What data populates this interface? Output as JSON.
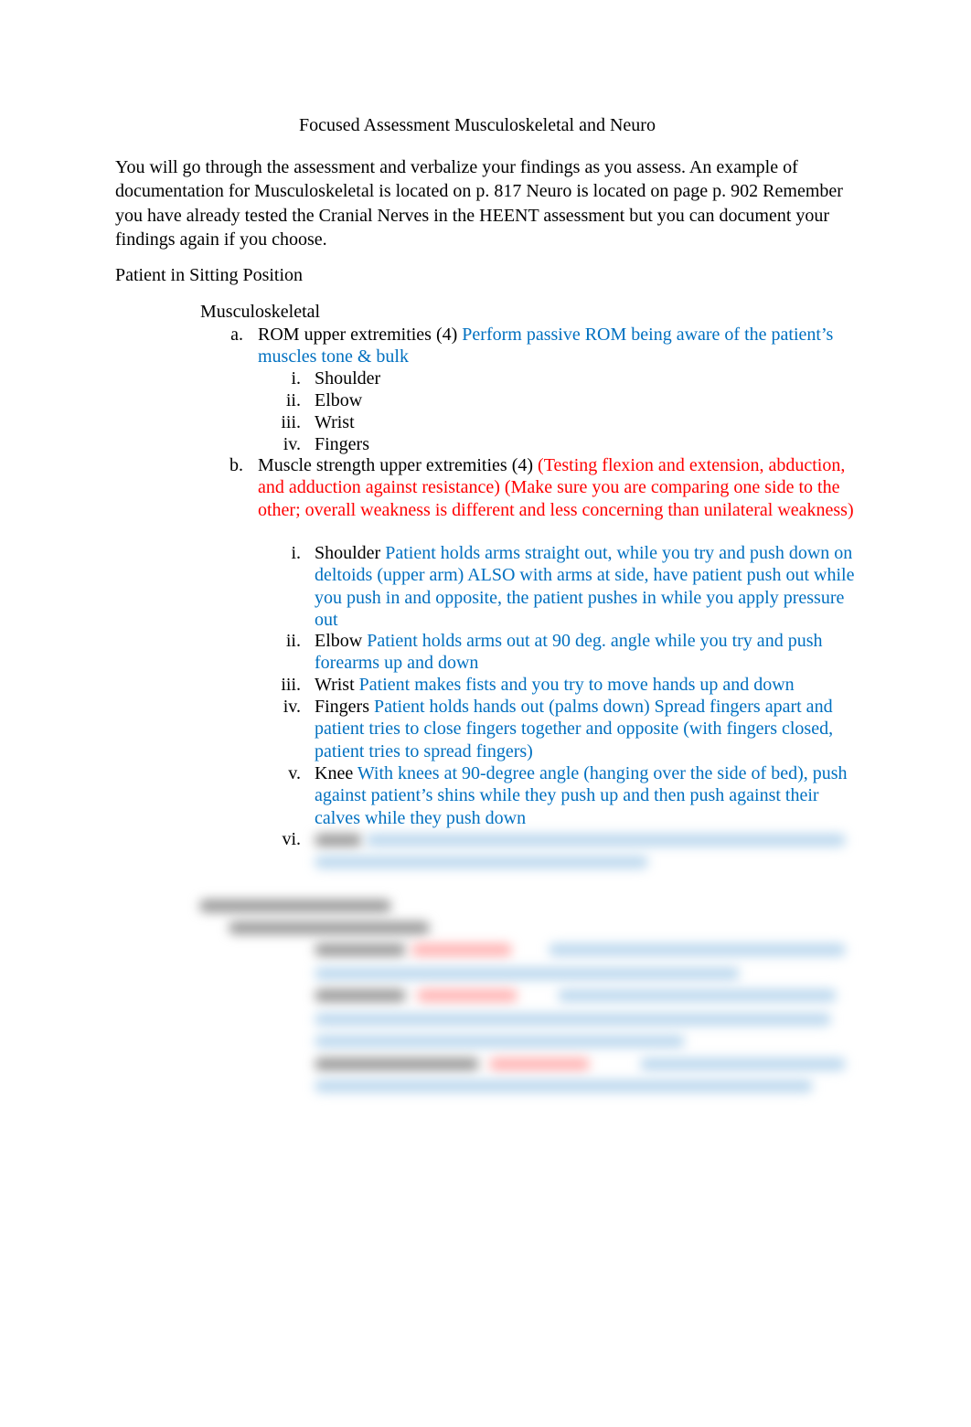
{
  "document": {
    "title": "Focused Assessment Musculoskeletal and Neuro",
    "intro": "You will go through the assessment and verbalize your findings as you assess. An example of documentation for Musculoskeletal is located on p. 817 Neuro is located on page p. 902 Remember you have already tested the Cranial Nerves in the HEENT assessment but you can document your findings again if you choose.",
    "section_heading": "Patient in Sitting Position",
    "subsection_heading": "Musculoskeletal",
    "colors": {
      "text": "#000000",
      "blue_note": "#0070C0",
      "red_note": "#FF0000"
    },
    "items": [
      {
        "marker": "a.",
        "label": "ROM upper extremities (4)",
        "note_blue": "Perform passive ROM being aware of the patient’s muscles tone & bulk",
        "subitems": [
          {
            "marker": "i.",
            "label": "Shoulder"
          },
          {
            "marker": "ii.",
            "label": "Elbow"
          },
          {
            "marker": "iii.",
            "label": "Wrist"
          },
          {
            "marker": "iv.",
            "label": "Fingers"
          }
        ]
      },
      {
        "marker": "b.",
        "label": "Muscle strength upper extremities (4)",
        "note_red": "(Testing flexion and extension, abduction, and adduction against resistance) (Make sure you are comparing one side to the other; overall weakness is different and less concerning than unilateral weakness)",
        "subitems": [
          {
            "marker": "i.",
            "label": "Shoulder",
            "note_blue": "Patient holds arms straight out, while you try and push down on deltoids (upper arm) ALSO with arms at side, have patient push out while you push in and opposite, the patient pushes in while you apply pressure out"
          },
          {
            "marker": "ii.",
            "label": "Elbow",
            "note_blue": "Patient holds arms out at 90 deg. angle while you try and push forearms up and down"
          },
          {
            "marker": "iii.",
            "label": "Wrist",
            "note_blue": "Patient makes fists and you try to move hands up and down"
          },
          {
            "marker": "iv.",
            "label": "Fingers",
            "note_blue": "Patient holds hands out (palms down) Spread fingers apart and patient tries to close fingers together and opposite (with fingers closed, patient tries to spread fingers)"
          },
          {
            "marker": "v.",
            "label": "Knee",
            "note_blue": "With knees at 90-degree angle (hanging over the side of bed), push against patient’s shins while they push up and then push against their calves while they push down"
          },
          {
            "marker": "vi.",
            "label": "",
            "note_blue": "",
            "blurred": true
          }
        ]
      }
    ],
    "blurred_section": {
      "visible": false
    }
  }
}
